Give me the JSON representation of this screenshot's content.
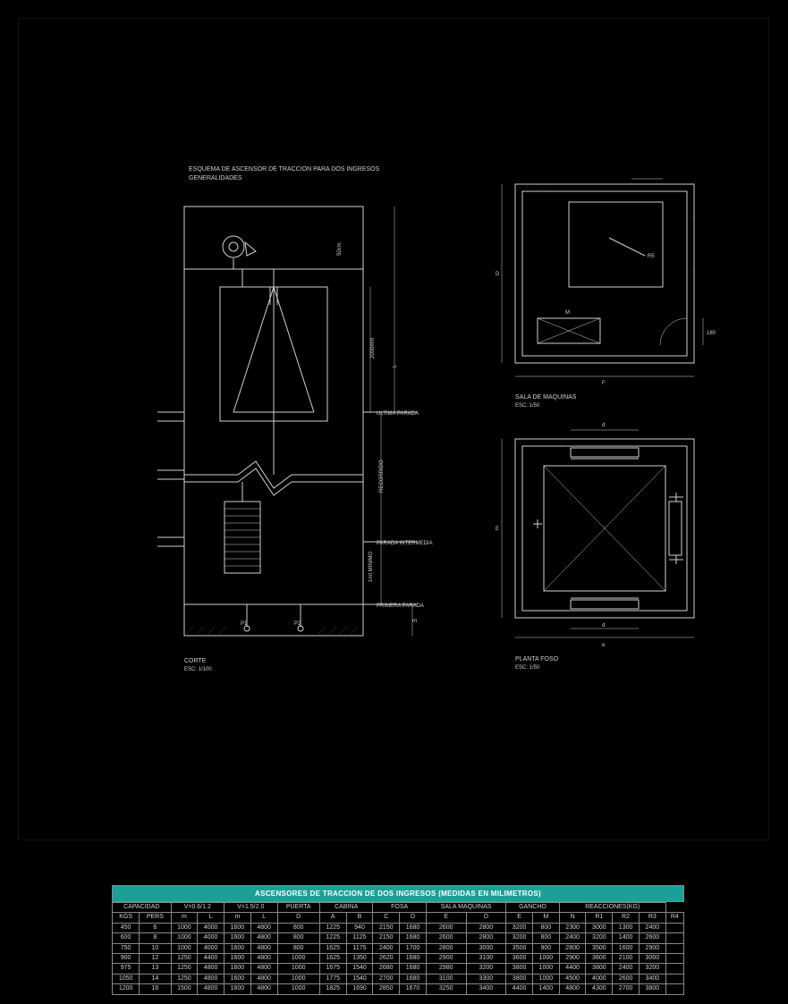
{
  "header": {
    "title_line1": "ESQUEMA DE ASCENSOR DE TRACCION PARA DOS INGRESOS",
    "title_line2": "GENERALIDADES"
  },
  "section_view": {
    "caption_line1": "CORTE",
    "caption_line2": "ESC: 1/100",
    "labels": {
      "ultima_parada": "ULTIMA PARADA",
      "parada_intermedia": "PARADA INTERMEDIA",
      "primera_parada": "PRIMERA PARADA",
      "recorrido": "RECORRIDO",
      "dim_L": "L",
      "dim_m": "m",
      "dim_mid": "1mt MINIMO",
      "dim_2000": "2000mm",
      "dim_50cm": "50cm",
      "p1": "P1",
      "p2": "P2"
    }
  },
  "machine_room": {
    "caption_line1": "SALA DE MAQUINAS",
    "caption_line2": "ESC: 1/50",
    "labels": {
      "F": "F",
      "D": "D",
      "M": "M",
      "R5": "R5",
      "arc": "180"
    }
  },
  "planta_foso": {
    "caption_line1": "PLANTA FOSO",
    "caption_line2": "ESC: 1/50",
    "labels": {
      "d_top": "d",
      "d_bottom": "d",
      "E": "E",
      "e": "e"
    }
  },
  "table": {
    "title": "ASCENSORES DE TRACCION DE DOS INGRESOS (MEDIDAS EN MILIMETROS)",
    "group_headers": [
      "CAPACIDAD",
      "V=0.6/1.2",
      "V=1.5/2.0",
      "PUERTA",
      "CABINA",
      "FOSA",
      "SALA MAQUINAS",
      "GANCHO",
      "REACCIONES(KG)"
    ],
    "group_spans": [
      2,
      2,
      2,
      1,
      2,
      2,
      2,
      2,
      4
    ],
    "sub_headers": [
      "KGS",
      "PERS",
      "m",
      "L",
      "m",
      "L",
      "D",
      "A",
      "B",
      "C",
      "D",
      "E",
      "D",
      "E",
      "M",
      "N",
      "R1",
      "R2",
      "R3",
      "R4"
    ],
    "rows": [
      [
        "450",
        "6",
        "1000",
        "4000",
        "1600",
        "4800",
        "800",
        "1225",
        "940",
        "2150",
        "1680",
        "2600",
        "2800",
        "3200",
        "800",
        "2300",
        "3000",
        "1300",
        "2400"
      ],
      [
        "600",
        "8",
        "1000",
        "4000",
        "1600",
        "4800",
        "800",
        "1225",
        "1125",
        "2150",
        "1680",
        "2600",
        "2800",
        "3200",
        "800",
        "2400",
        "3200",
        "1400",
        "2600"
      ],
      [
        "750",
        "10",
        "1000",
        "4000",
        "1600",
        "4800",
        "800",
        "1625",
        "1175",
        "2400",
        "1700",
        "2800",
        "3000",
        "3500",
        "900",
        "2800",
        "3500",
        "1600",
        "2900"
      ],
      [
        "900",
        "12",
        "1250",
        "4400",
        "1600",
        "4800",
        "1000",
        "1625",
        "1350",
        "2620",
        "1680",
        "2900",
        "3100",
        "3600",
        "1000",
        "2900",
        "3600",
        "2100",
        "3000"
      ],
      [
        "975",
        "13",
        "1250",
        "4800",
        "1600",
        "4800",
        "1000",
        "1675",
        "1540",
        "2680",
        "1680",
        "2980",
        "3200",
        "3800",
        "1000",
        "4400",
        "3800",
        "2400",
        "3200"
      ],
      [
        "1050",
        "14",
        "1250",
        "4800",
        "1600",
        "4800",
        "1000",
        "1775",
        "1540",
        "2700",
        "1680",
        "3100",
        "3300",
        "3800",
        "1000",
        "4500",
        "4000",
        "2600",
        "3400"
      ],
      [
        "1200",
        "16",
        "1500",
        "4800",
        "1600",
        "4800",
        "1000",
        "1825",
        "1690",
        "2850",
        "1670",
        "3250",
        "3400",
        "4400",
        "1400",
        "4800",
        "4300",
        "2700",
        "3800"
      ]
    ]
  }
}
